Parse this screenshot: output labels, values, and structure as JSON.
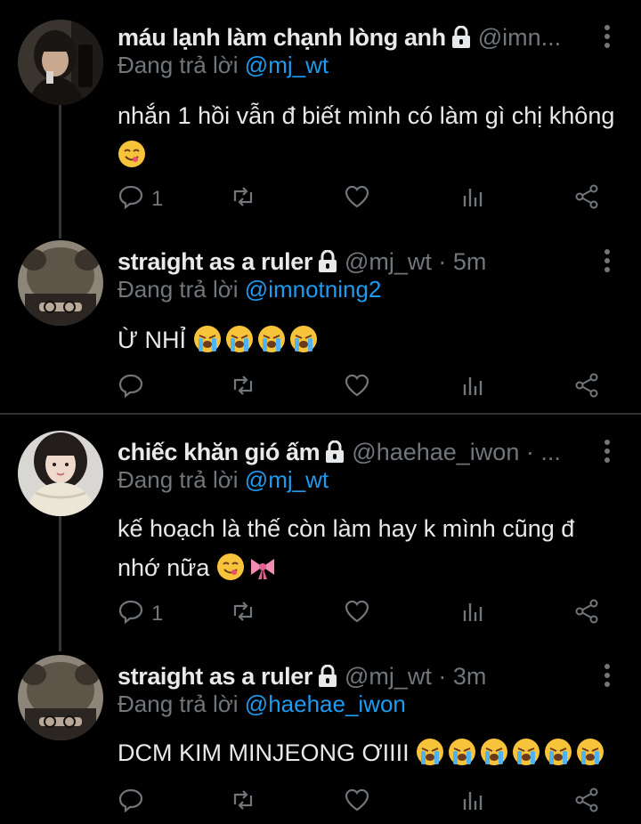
{
  "tweets": [
    {
      "name": "máu lạnh làm chạnh lòng anh",
      "handle": "@imn...",
      "replying_label": "Đang trả lời",
      "replying_to": "@mj_wt",
      "text": "nhắn 1 hồi vẫn đ biết mình có làm gì chị không",
      "emojis": [
        "yum"
      ],
      "reply_count": "1"
    },
    {
      "name": "straight as a ruler",
      "handle": "@mj_wt · 5m",
      "replying_label": "Đang trả lời",
      "replying_to": "@imnotning2",
      "text": "Ừ NHỈ",
      "emojis": [
        "sob",
        "sob",
        "sob",
        "sob"
      ],
      "reply_count": ""
    },
    {
      "name": "chiếc khăn gió ấm",
      "handle": "@haehae_iwon · ...",
      "replying_label": "Đang trả lời",
      "replying_to": "@mj_wt",
      "text": "kế hoạch là thế còn làm hay k mình cũng đ nhớ nữa",
      "emojis": [
        "yum",
        "ribbon"
      ],
      "reply_count": "1"
    },
    {
      "name": "straight as a ruler",
      "handle": "@mj_wt · 3m",
      "replying_label": "Đang trả lời",
      "replying_to": "@haehae_iwon",
      "text": "DCM KIM MINJEONG ƠIIII",
      "emojis": [
        "sob",
        "sob",
        "sob",
        "sob",
        "sob",
        "sob"
      ],
      "reply_count": ""
    }
  ],
  "icons": {
    "reply": "reply-icon",
    "retweet": "retweet-icon",
    "like": "heart-icon",
    "views": "views-icon",
    "share": "share-icon",
    "lock": "lock-icon",
    "more": "more-vertical-icon"
  },
  "colors": {
    "background": "#000000",
    "text": "#e7e9ea",
    "muted": "#71767b",
    "mention": "#1d9bf0",
    "divider": "#2f3336"
  }
}
